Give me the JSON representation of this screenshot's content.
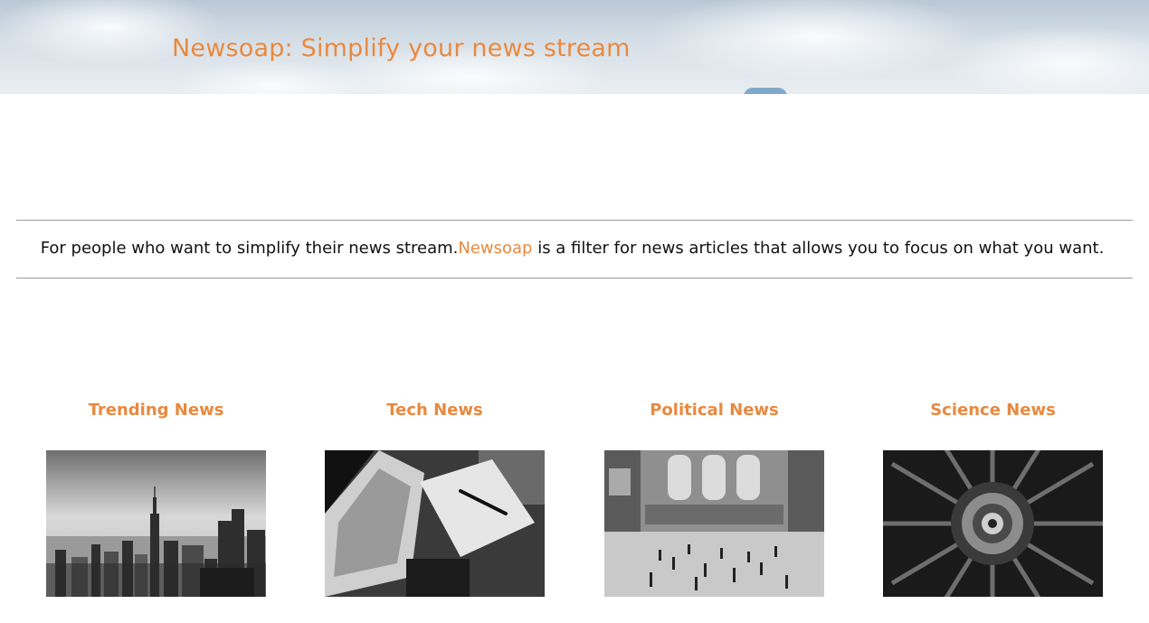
{
  "header": {
    "title": "Newsoap: Simplify your news stream"
  },
  "tagline": {
    "before": "For people who want to simplify their news stream.",
    "brand": "Newsoap",
    "after": " is a filter for news articles that allows you to focus on what you want."
  },
  "categories": [
    {
      "label": "Trending News",
      "image": "city-skyline-photo"
    },
    {
      "label": "Tech News",
      "image": "laptop-notebook-photo"
    },
    {
      "label": "Political News",
      "image": "train-station-crowd-photo"
    },
    {
      "label": "Science News",
      "image": "jet-engine-photo"
    }
  ],
  "colors": {
    "accent": "#e8893f",
    "text": "#111111",
    "rule": "#9a9a9a"
  }
}
